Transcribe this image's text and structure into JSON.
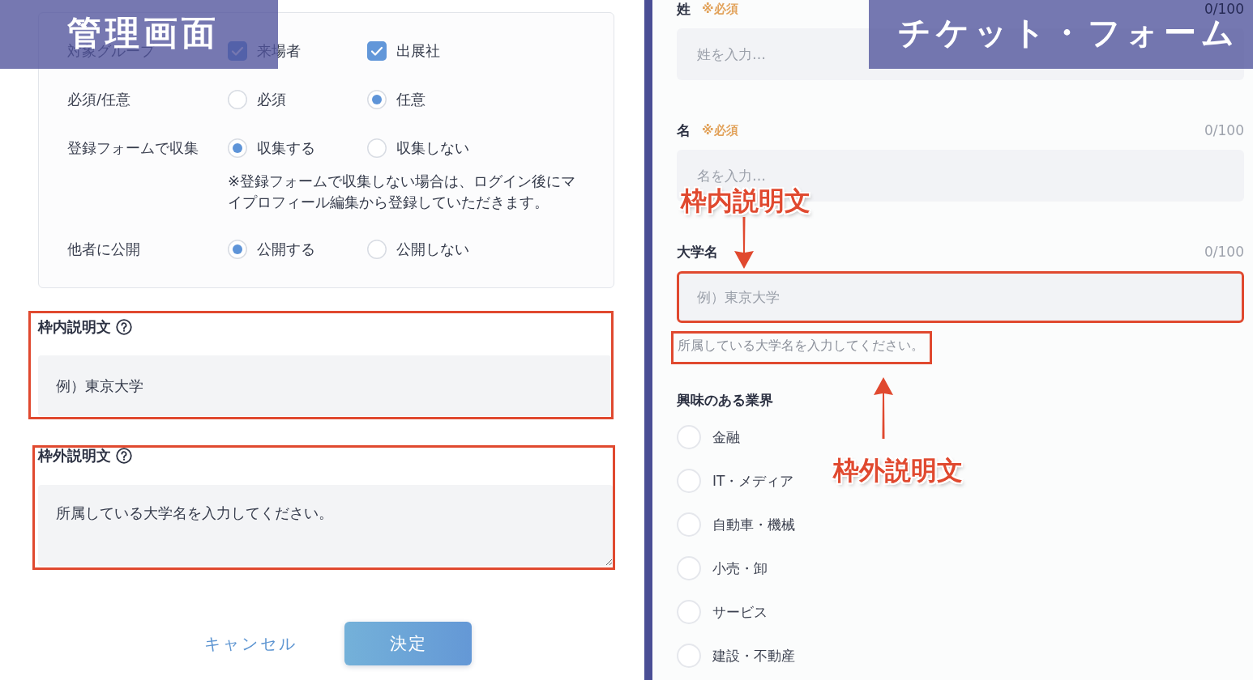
{
  "admin_panel": {
    "banner": "管理画面",
    "settings": [
      {
        "kind": "checkbox",
        "label": "対象グループ",
        "options": [
          {
            "label": "来場者",
            "checked": true
          },
          {
            "label": "出展社",
            "checked": true
          }
        ]
      },
      {
        "kind": "radio",
        "label": "必須/任意",
        "options": [
          {
            "label": "必須",
            "selected": false
          },
          {
            "label": "任意",
            "selected": true
          }
        ]
      },
      {
        "kind": "radio",
        "label": "登録フォームで収集",
        "options": [
          {
            "label": "収集する",
            "selected": true
          },
          {
            "label": "収集しない",
            "selected": false
          }
        ],
        "note": "※登録フォームで収集しない場合は、ログイン後にマイプロフィール編集から登録していただきます。"
      },
      {
        "kind": "radio",
        "label": "他者に公開",
        "options": [
          {
            "label": "公開する",
            "selected": true
          },
          {
            "label": "公開しない",
            "selected": false
          }
        ]
      }
    ],
    "inner_description": {
      "label": "枠内説明文",
      "value": "例）東京大学",
      "highlighted": true
    },
    "outer_description": {
      "label": "枠外説明文",
      "value": "所属している大学名を入力してください。",
      "highlighted": true
    },
    "buttons": [
      {
        "label": "キャンセル",
        "kind": "secondary"
      },
      {
        "label": "決定",
        "kind": "primary"
      }
    ]
  },
  "ticket_form": {
    "banner": "チケット・フォーム",
    "fields": [
      {
        "label": "姓",
        "required_mark": "※必須",
        "counter": "0/100",
        "placeholder": "姓を入力…",
        "highlighted": false
      },
      {
        "label": "名",
        "required_mark": "※必須",
        "counter": "0/100",
        "placeholder": "名を入力…",
        "highlighted": false
      },
      {
        "label": "大学名",
        "counter": "0/100",
        "placeholder": "例）東京大学",
        "highlighted": true,
        "help": {
          "text": "所属している大学名を入力してください。",
          "highlighted": true
        }
      }
    ],
    "industry": {
      "label": "興味のある業界",
      "options": [
        {
          "label": "金融",
          "selected": false
        },
        {
          "label": "IT・メディア",
          "selected": false
        },
        {
          "label": "自動車・機械",
          "selected": false
        },
        {
          "label": "小売・卸",
          "selected": false
        },
        {
          "label": "サービス",
          "selected": false
        },
        {
          "label": "建設・不動産",
          "selected": false
        }
      ]
    }
  },
  "annotations": [
    {
      "text": "枠内説明文",
      "kind": "down"
    },
    {
      "text": "枠外説明文",
      "kind": "up"
    }
  ]
}
